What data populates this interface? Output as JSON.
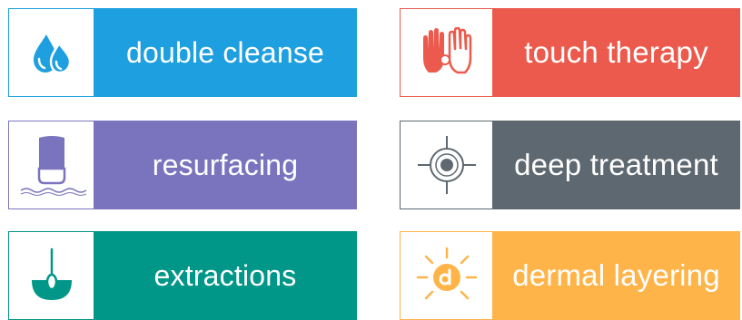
{
  "tiles": [
    {
      "label": "double cleanse",
      "icon": "water-drops-icon",
      "color": "#1e9fe0"
    },
    {
      "label": "touch therapy",
      "icon": "hands-icon",
      "color": "#eb5a4c"
    },
    {
      "label": "resurfacing",
      "icon": "resurfacing-tool-icon",
      "color": "#7a74bf"
    },
    {
      "label": "deep treatment",
      "icon": "target-icon",
      "color": "#5e6870"
    },
    {
      "label": "extractions",
      "icon": "extraction-loop-icon",
      "color": "#009688"
    },
    {
      "label": "dermal layering",
      "icon": "sun-d-icon",
      "color": "#ffb449"
    }
  ]
}
